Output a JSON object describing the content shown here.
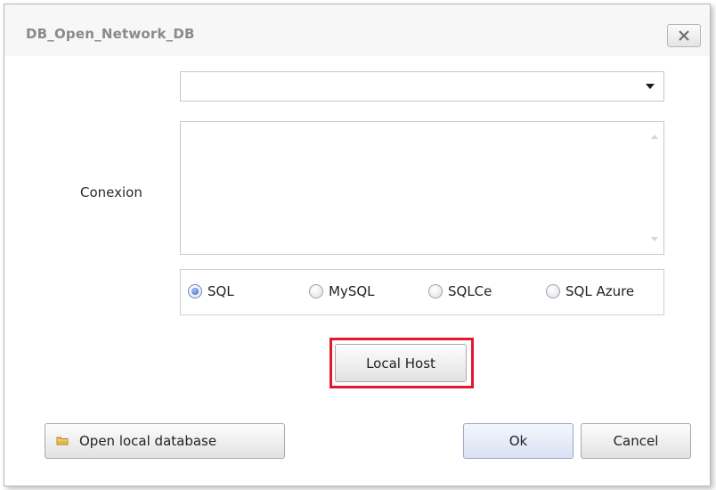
{
  "dialog": {
    "title": "DB_Open_Network_DB",
    "close_glyph": "✕",
    "close_icon": "close-icon"
  },
  "connection": {
    "label": "Conexion",
    "combo_value": "",
    "combo_icon": "chevron-down-icon",
    "memo_value": ""
  },
  "db_types": [
    {
      "label": "SQL",
      "checked": true
    },
    {
      "label": "MySQL",
      "checked": false
    },
    {
      "label": "SQLCe",
      "checked": false
    },
    {
      "label": "SQL Azure",
      "checked": false
    }
  ],
  "buttons": {
    "local_host": "Local Host",
    "open_local": "Open local database",
    "open_local_icon": "folder-icon",
    "ok": "Ok",
    "cancel": "Cancel"
  },
  "colors": {
    "highlight": "#e3182f",
    "radio_accent": "#4f77c4"
  }
}
